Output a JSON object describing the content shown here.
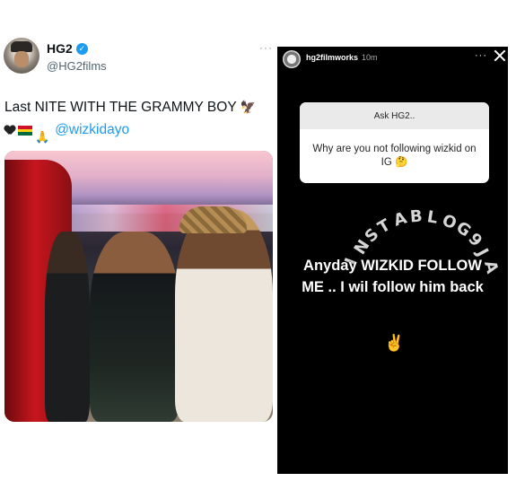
{
  "tweet": {
    "display_name": "HG2",
    "verified_icon": "✓",
    "handle": "@HG2films",
    "more": "···",
    "text_line1": "Last NITE WITH THE GRAMMY BOY",
    "text_line1_emoji": "🦅",
    "flag_colors": [
      "#ce1126",
      "#fcd116",
      "#006b3f"
    ],
    "pray_emoji": "🙏",
    "mention": "@wizkidayo"
  },
  "story": {
    "username": "hg2filmworks",
    "time": "10m",
    "more": "···",
    "question_header": "Ask HG2..",
    "question": "Why are you not following wizkid on IG 🤔",
    "caption_line1": "Anyday WIZKID FOLLOW",
    "caption_line2": "ME .. I wil follow him back",
    "peace_emoji": "✌",
    "watermark_letters": [
      "I",
      "N",
      "S",
      "T",
      "A",
      "B",
      "L",
      "O",
      "G",
      "9",
      "J",
      "A"
    ]
  }
}
